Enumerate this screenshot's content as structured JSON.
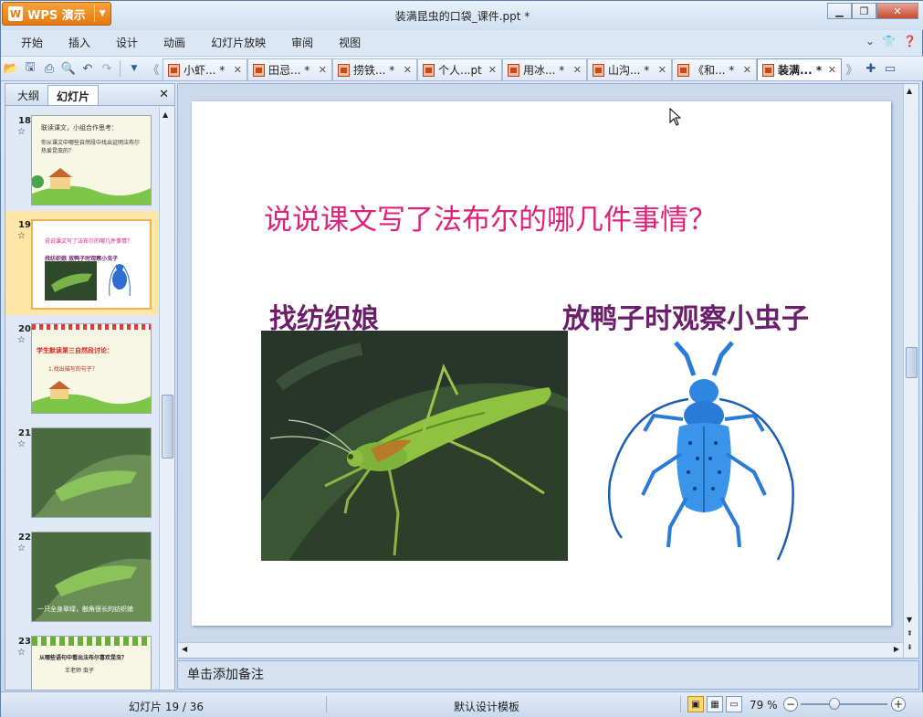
{
  "app": {
    "name": "WPS 演示",
    "logo_letter": "W"
  },
  "window": {
    "title": "装满昆虫的口袋_课件.ppt *"
  },
  "menu": [
    "开始",
    "插入",
    "设计",
    "动画",
    "幻灯片放映",
    "审阅",
    "视图"
  ],
  "menu_right_icons": [
    "chevron-down-icon",
    "shirt-icon",
    "help-icon"
  ],
  "doc_tabs": [
    {
      "label": "小虾... *"
    },
    {
      "label": "田忌... *"
    },
    {
      "label": "捞铁... *"
    },
    {
      "label": "个人...pt"
    },
    {
      "label": "用冰... *"
    },
    {
      "label": "山沟... *"
    },
    {
      "label": "《和... *"
    },
    {
      "label": "装满... *",
      "active": true
    }
  ],
  "left_pane": {
    "tabs": [
      {
        "label": "大纲"
      },
      {
        "label": "幻灯片",
        "active": true
      }
    ],
    "thumbnails": [
      {
        "num": "18",
        "text": "联读课文，小组合作思考：",
        "subtext": "你从课文中哪些自然段中找出证明法布尔热爱昆虫的？"
      },
      {
        "num": "19",
        "selected": true,
        "text": "说说课文写了法布尔的哪几件事情？",
        "subtext": "找纺织娘  放鸭子时观察小虫子"
      },
      {
        "num": "20",
        "text": "学生默读第三自然段讨论：",
        "subtext": "1.找出描写的句子？"
      },
      {
        "num": "21"
      },
      {
        "num": "22",
        "text": "一只全身翠绿，触角很长的纺织娘"
      },
      {
        "num": "23",
        "text": "从哪些语句中看出法布尔喜欢昆虫？",
        "subtext": "王老师  虫子"
      }
    ]
  },
  "slide": {
    "title": "说说课文写了法布尔的哪几件事情？",
    "caption_left": "找纺织娘",
    "caption_right": "放鸭子时观察小虫子"
  },
  "notes_placeholder": "单击添加备注",
  "status": {
    "slide_counter": "幻灯片 19 / 36",
    "template": "默认设计模板",
    "zoom": "79 %",
    "zoom_level_percent": 79
  },
  "colors": {
    "title_pink": "#e0217a",
    "caption_purple": "#6b1f6b",
    "wps_orange": "#e5780f"
  }
}
